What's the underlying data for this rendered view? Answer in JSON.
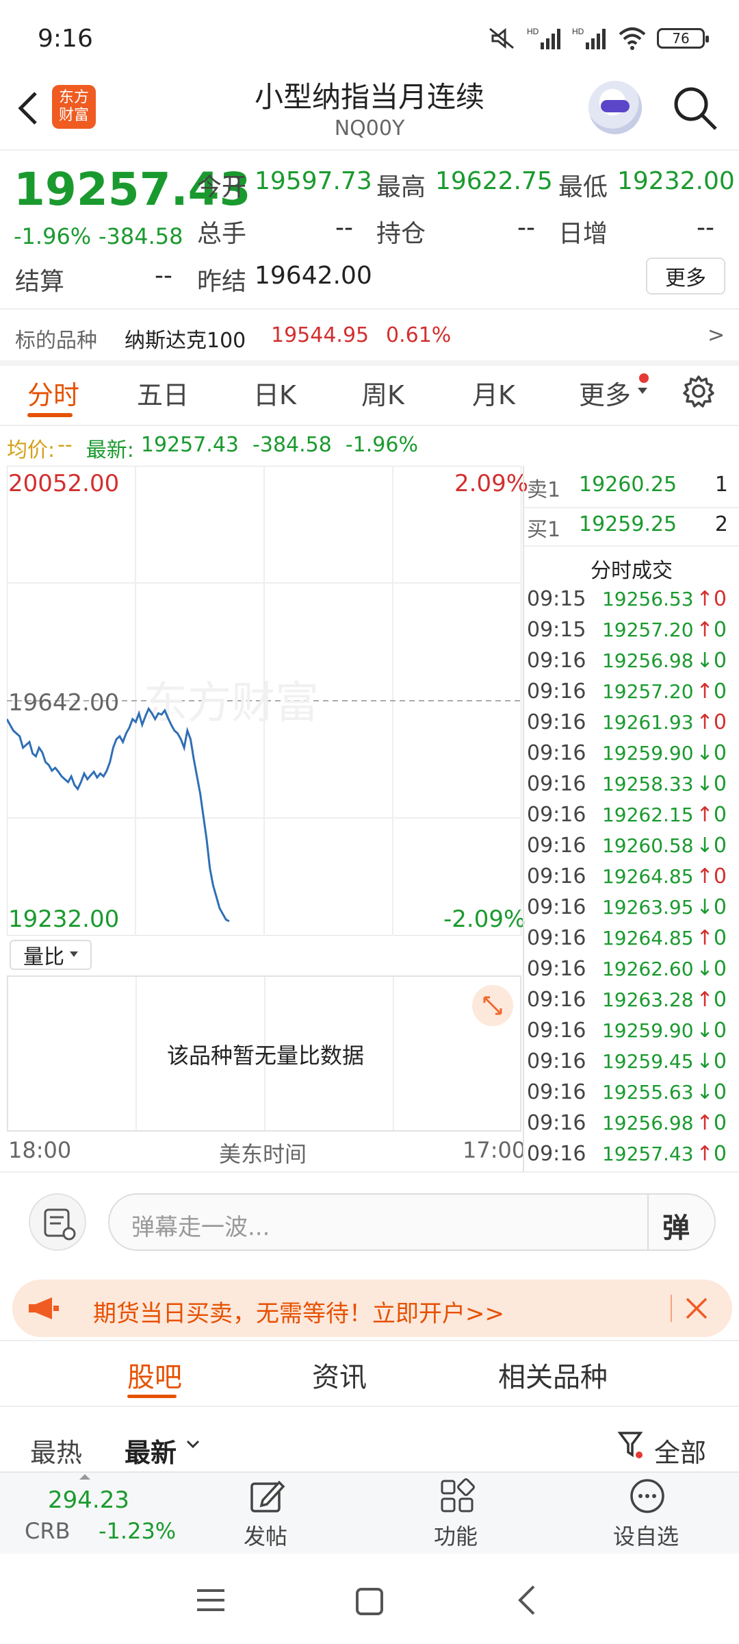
{
  "status_bar": {
    "time": "9:16",
    "battery": "76",
    "icons": [
      "mute-icon",
      "signal-hd-icon",
      "signal-hd-icon",
      "wifi-icon",
      "battery-icon"
    ]
  },
  "header": {
    "title": "小型纳指当月连续",
    "code": "NQ00Y",
    "logo_line1": "东方",
    "logo_line2": "财富"
  },
  "quote": {
    "price": "19257.43",
    "change_pct": "-1.96%",
    "change": "-384.58",
    "open_label": "今开",
    "open": "19597.73",
    "high_label": "最高",
    "high": "19622.75",
    "low_label": "最低",
    "low": "19232.00",
    "volume_label": "总手",
    "volume": "--",
    "oi_label": "持仓",
    "oi": "--",
    "daily_inc_label": "日增",
    "daily_inc": "--",
    "settle_label": "结算",
    "settle": "--",
    "prev_settle_label": "昨结",
    "prev_settle": "19642.00",
    "more_button": "更多"
  },
  "underlying": {
    "label": "标的品种",
    "name": "纳斯达克100",
    "price": "19544.95",
    "pct": "0.61%",
    "arrow": ">"
  },
  "tabs": [
    "分时",
    "五日",
    "日K",
    "周K",
    "月K",
    "更多"
  ],
  "info_line": {
    "avg_label": "均价:",
    "avg_value": "--",
    "latest_label": "最新:",
    "latest_value": "19257.43",
    "change": "-384.58",
    "pct": "-1.96%"
  },
  "chart_data": {
    "type": "line",
    "y_top_label": "20052.00",
    "y_top_pct": "2.09%",
    "y_mid_label": "19642.00",
    "y_bottom_label": "19232.00",
    "y_bottom_pct": "-2.09%",
    "x_start": "18:00",
    "x_mid": "美东时间",
    "x_end": "17:00",
    "ylim": [
      19232.0,
      20052.0
    ],
    "reference": 19642.0,
    "watermark": "东方财富",
    "values": [
      19610,
      19600,
      19590,
      19585,
      19580,
      19560,
      19565,
      19570,
      19550,
      19545,
      19560,
      19552,
      19535,
      19530,
      19520,
      19525,
      19518,
      19510,
      19505,
      19500,
      19510,
      19495,
      19488,
      19500,
      19515,
      19505,
      19512,
      19518,
      19508,
      19515,
      19510,
      19520,
      19535,
      19560,
      19575,
      19580,
      19570,
      19585,
      19595,
      19610,
      19605,
      19620,
      19600,
      19615,
      19628,
      19620,
      19610,
      19620,
      19618,
      19625,
      19612,
      19600,
      19590,
      19585,
      19575,
      19560,
      19590,
      19575,
      19540,
      19510,
      19480,
      19440,
      19400,
      19350,
      19320,
      19300,
      19280,
      19270,
      19260,
      19257.43
    ],
    "color": "#2f6fb5"
  },
  "order_book": {
    "sell_label": "卖1",
    "sell_price": "19260.25",
    "sell_vol": "1",
    "buy_label": "买1",
    "buy_price": "19259.25",
    "buy_vol": "2"
  },
  "trades": {
    "title": "分时成交",
    "rows": [
      {
        "time": "09:15",
        "price": "19256.53",
        "dir": "↑",
        "vol": "0",
        "vol_color": "red"
      },
      {
        "time": "09:15",
        "price": "19257.20",
        "dir": "↑",
        "vol": "0",
        "vol_color": "green"
      },
      {
        "time": "09:16",
        "price": "19256.98",
        "dir": "↓",
        "vol": "0",
        "vol_color": "green"
      },
      {
        "time": "09:16",
        "price": "19257.20",
        "dir": "↑",
        "vol": "0",
        "vol_color": "green"
      },
      {
        "time": "09:16",
        "price": "19261.93",
        "dir": "↑",
        "vol": "0",
        "vol_color": "red"
      },
      {
        "time": "09:16",
        "price": "19259.90",
        "dir": "↓",
        "vol": "0",
        "vol_color": "green"
      },
      {
        "time": "09:16",
        "price": "19258.33",
        "dir": "↓",
        "vol": "0",
        "vol_color": "green"
      },
      {
        "time": "09:16",
        "price": "19262.15",
        "dir": "↑",
        "vol": "0",
        "vol_color": "green"
      },
      {
        "time": "09:16",
        "price": "19260.58",
        "dir": "↓",
        "vol": "0",
        "vol_color": "green"
      },
      {
        "time": "09:16",
        "price": "19264.85",
        "dir": "↑",
        "vol": "0",
        "vol_color": "red"
      },
      {
        "time": "09:16",
        "price": "19263.95",
        "dir": "↓",
        "vol": "0",
        "vol_color": "green"
      },
      {
        "time": "09:16",
        "price": "19264.85",
        "dir": "↑",
        "vol": "0",
        "vol_color": "green"
      },
      {
        "time": "09:16",
        "price": "19262.60",
        "dir": "↓",
        "vol": "0",
        "vol_color": "green"
      },
      {
        "time": "09:16",
        "price": "19263.28",
        "dir": "↑",
        "vol": "0",
        "vol_color": "green"
      },
      {
        "time": "09:16",
        "price": "19259.90",
        "dir": "↓",
        "vol": "0",
        "vol_color": "green"
      },
      {
        "time": "09:16",
        "price": "19259.45",
        "dir": "↓",
        "vol": "0",
        "vol_color": "green"
      },
      {
        "time": "09:16",
        "price": "19255.63",
        "dir": "↓",
        "vol": "0",
        "vol_color": "green"
      },
      {
        "time": "09:16",
        "price": "19256.98",
        "dir": "↑",
        "vol": "0",
        "vol_color": "green"
      },
      {
        "time": "09:16",
        "price": "19257.43",
        "dir": "↑",
        "vol": "0",
        "vol_color": "green"
      }
    ]
  },
  "volume_ratio": {
    "dropdown": "量比",
    "empty_text": "该品种暂无量比数据"
  },
  "comment": {
    "placeholder": "弹幕走一波...",
    "danmu_button": "弹"
  },
  "banner": {
    "text": "期货当日买卖，无需等待！立即开户>>"
  },
  "section_tabs": [
    "股吧",
    "资讯",
    "相关品种"
  ],
  "sort": {
    "hot": "最热",
    "latest": "最新",
    "filter": "全部"
  },
  "bottom_bar": {
    "crb_value": "294.23",
    "crb_name": "CRB",
    "crb_pct": "-1.23%",
    "post": "发帖",
    "function": "功能",
    "watchlist": "设自选"
  },
  "colors": {
    "up": "#d32f2f",
    "down": "#1a9a2e",
    "accent": "#e65100",
    "line": "#2f6fb5"
  }
}
